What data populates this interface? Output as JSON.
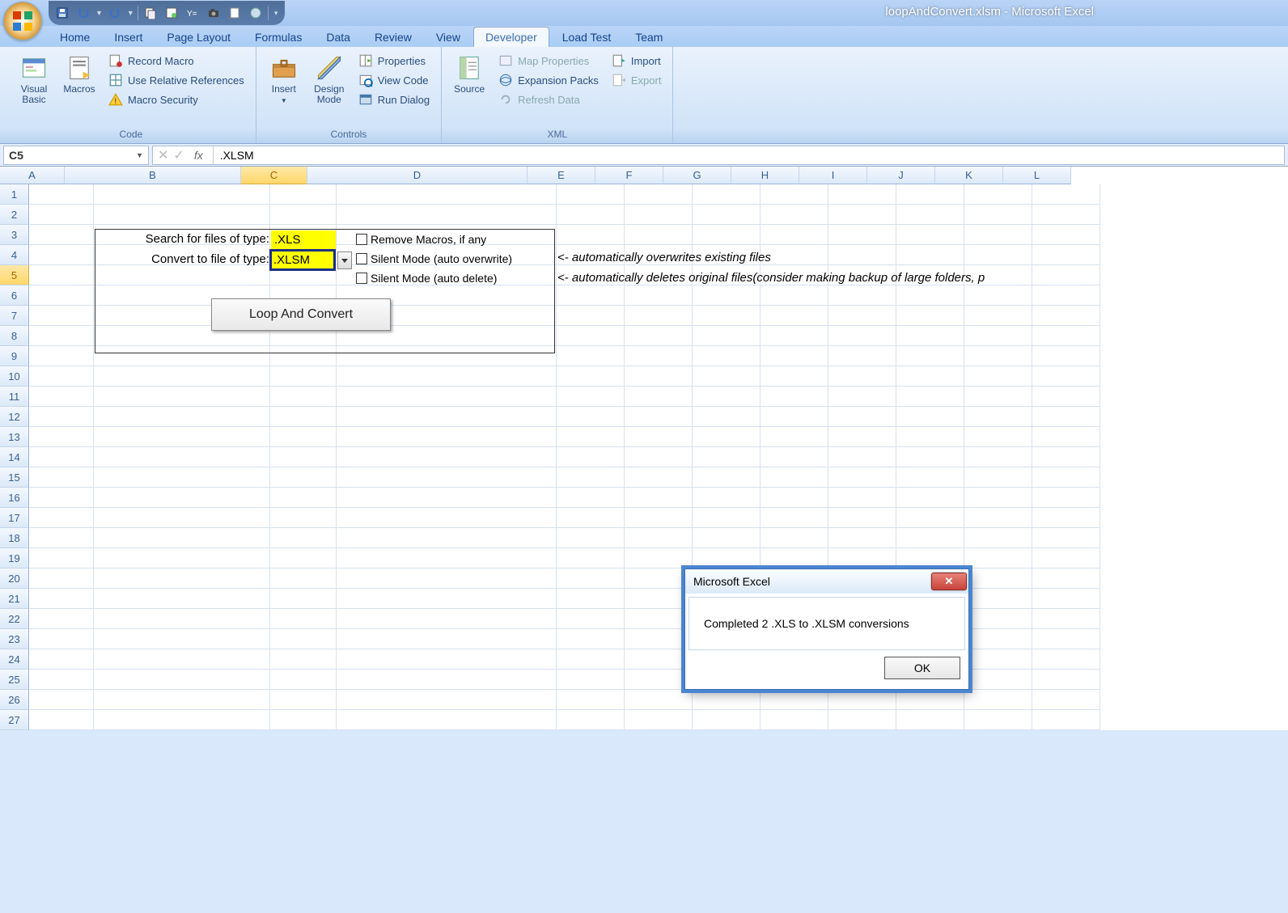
{
  "title": "loopAndConvert.xlsm - Microsoft Excel",
  "tabs": [
    "Home",
    "Insert",
    "Page Layout",
    "Formulas",
    "Data",
    "Review",
    "View",
    "Developer",
    "Load Test",
    "Team"
  ],
  "active_tab": 7,
  "ribbon": {
    "code": {
      "label": "Code",
      "visual_basic": "Visual Basic",
      "macros": "Macros",
      "record": "Record Macro",
      "relative": "Use Relative References",
      "security": "Macro Security"
    },
    "controls": {
      "label": "Controls",
      "insert": "Insert",
      "design": "Design Mode",
      "properties": "Properties",
      "view_code": "View Code",
      "run_dialog": "Run Dialog"
    },
    "xml": {
      "label": "XML",
      "source": "Source",
      "map_props": "Map Properties",
      "expansion": "Expansion Packs",
      "refresh": "Refresh Data",
      "import": "Import",
      "export": "Export"
    }
  },
  "namebox": "C5",
  "formula": ".XLSM",
  "columns": [
    "A",
    "B",
    "C",
    "D",
    "E",
    "F",
    "G",
    "H",
    "I",
    "J",
    "K",
    "L"
  ],
  "row_count": 27,
  "selected_col": "C",
  "selected_row": 5,
  "form": {
    "label_search": "Search for files of type:",
    "label_convert": "Convert to file of type:",
    "val_search": ".XLS",
    "val_convert": ".XLSM",
    "chk_remove": "Remove Macros, if any",
    "chk_silent_ow": "Silent Mode (auto overwrite)",
    "chk_silent_del": "Silent Mode (auto delete)",
    "hint_ow": "<- automatically overwrites existing files",
    "hint_del": "<- automatically deletes original files(consider making backup of large folders, p",
    "button": "Loop And Convert"
  },
  "dialog": {
    "title": "Microsoft Excel",
    "message": "Completed 2 .XLS to .XLSM conversions",
    "ok": "OK"
  }
}
